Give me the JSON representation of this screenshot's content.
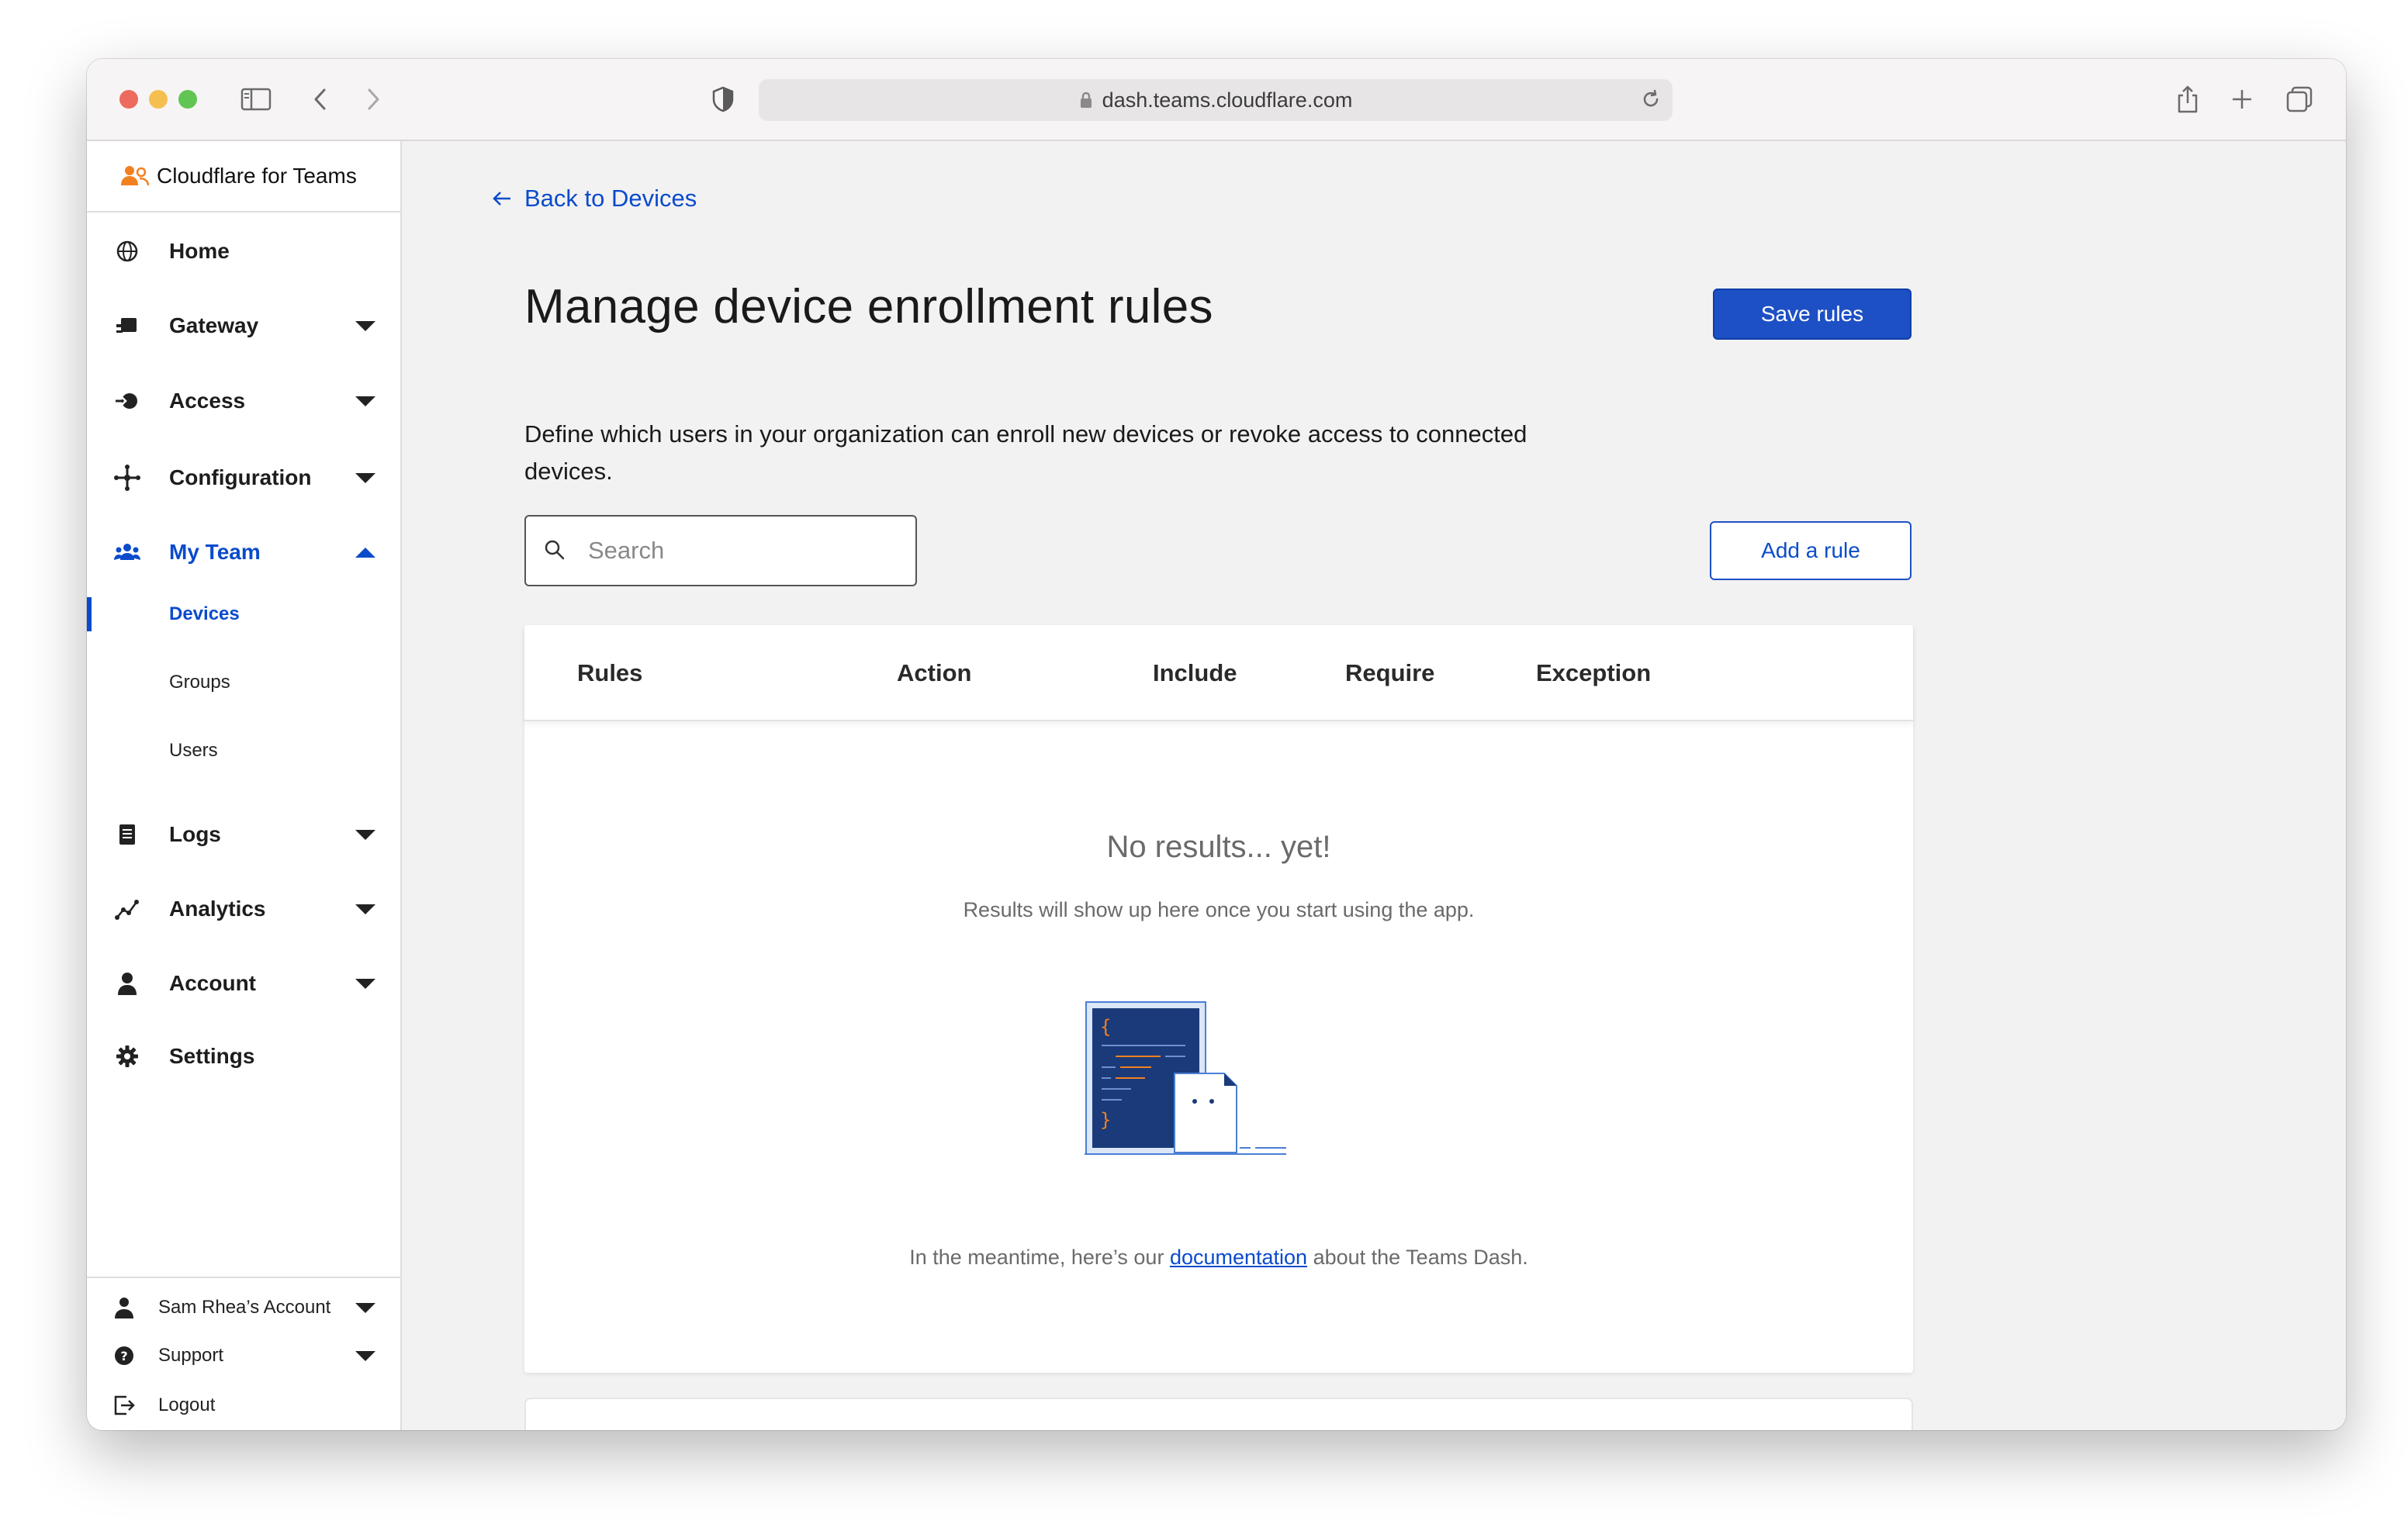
{
  "browser": {
    "url": "dash.teams.cloudflare.com"
  },
  "sidebar": {
    "brand": "Cloudflare for Teams",
    "items": [
      {
        "label": "Home",
        "icon": "globe-icon"
      },
      {
        "label": "Gateway",
        "icon": "gateway-icon"
      },
      {
        "label": "Access",
        "icon": "access-icon"
      },
      {
        "label": "Configuration",
        "icon": "configuration-icon"
      },
      {
        "label": "My Team",
        "icon": "team-icon"
      },
      {
        "label": "Logs",
        "icon": "logs-icon"
      },
      {
        "label": "Analytics",
        "icon": "analytics-icon"
      },
      {
        "label": "Account",
        "icon": "person-icon"
      },
      {
        "label": "Settings",
        "icon": "gear-icon"
      }
    ],
    "subitems": [
      {
        "label": "Devices"
      },
      {
        "label": "Groups"
      },
      {
        "label": "Users"
      }
    ],
    "footer": [
      {
        "label": "Sam Rhea’s Account",
        "icon": "person-icon"
      },
      {
        "label": "Support",
        "icon": "help-icon"
      },
      {
        "label": "Logout",
        "icon": "logout-icon"
      }
    ]
  },
  "main": {
    "back_label": "Back to Devices",
    "title": "Manage device enrollment rules",
    "save_label": "Save rules",
    "description": "Define which users in your organization can enroll new devices or revoke access to connected devices.",
    "search_placeholder": "Search",
    "add_rule_label": "Add a rule",
    "table": {
      "columns": [
        "Rules",
        "Action",
        "Include",
        "Require",
        "Exception"
      ]
    },
    "empty": {
      "title": "No results... yet!",
      "subtitle": "Results will show up here once you start using the app.",
      "meantime_prefix": "In the meantime, here’s our ",
      "link_text": "documentation",
      "meantime_suffix": " about the Teams Dash."
    }
  },
  "colors": {
    "accent": "#0a4bcc",
    "primary_button": "#1e50c5",
    "brand_orange": "#f38020"
  }
}
